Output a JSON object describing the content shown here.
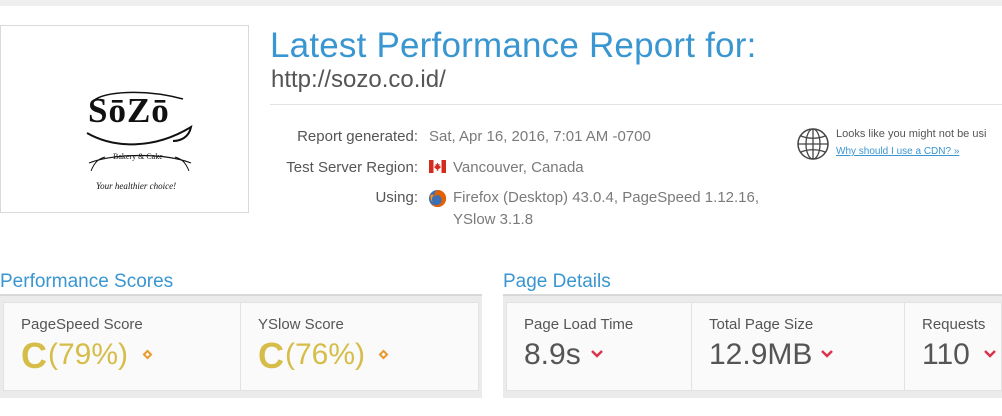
{
  "logo": {
    "wordmark": "SōZō",
    "subtitle": "Bakery & Cake",
    "tagline": "Your healthier choice!"
  },
  "header": {
    "title": "Latest Performance Report for:",
    "url": "http://sozo.co.id/"
  },
  "report": {
    "generated_label": "Report generated:",
    "generated_value": "Sat, Apr 16, 2016, 7:01 AM -0700",
    "region_label": "Test Server Region:",
    "region_value": "Vancouver, Canada",
    "using_label": "Using:",
    "using_line1": "Firefox (Desktop) 43.0.4, PageSpeed 1.12.16,",
    "using_line2": "YSlow 3.1.8"
  },
  "cdn": {
    "text": "Looks like you might not be usi",
    "link": "Why should I use a CDN? »",
    "icon": "globe-icon"
  },
  "performance_scores": {
    "title": "Performance Scores",
    "pagespeed": {
      "label": "PageSpeed Score",
      "grade": "C",
      "value": "(79%)"
    },
    "yslow": {
      "label": "YSlow Score",
      "grade": "C",
      "value": "(76%)"
    },
    "accent_color": "#d6bd4a"
  },
  "page_details": {
    "title": "Page Details",
    "load_time": {
      "label": "Page Load Time",
      "value": "8.9s"
    },
    "page_size": {
      "label": "Total Page Size",
      "value": "12.9MB"
    },
    "requests": {
      "label": "Requests",
      "value": "110"
    },
    "arrow_color": "#d9344b"
  },
  "colors": {
    "brand_blue": "#3996d1",
    "text": "#555555"
  }
}
